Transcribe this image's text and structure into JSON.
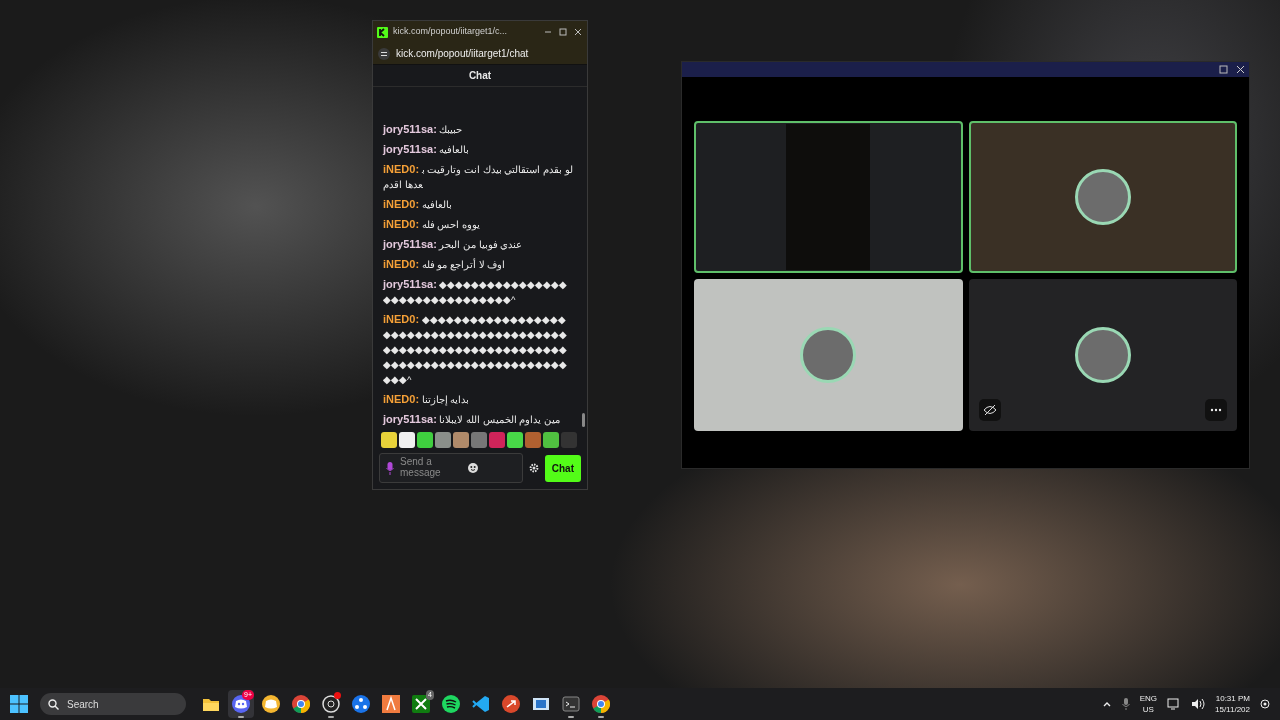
{
  "chat_window": {
    "title": "kick.com/popout/iitarget1/c...",
    "address": "kick.com/popout/iitarget1/chat",
    "header": "Chat",
    "messages": [
      {
        "user": "jory511sa:",
        "color": "#e4c9dd",
        "text": "حبيبك"
      },
      {
        "user": "jory511sa:",
        "color": "#e4c9dd",
        "text": "بالعافيه"
      },
      {
        "user": "iNED0:",
        "color": "#f5a037",
        "text": "لو بقدم استقالتي بيدك انت وتارقيت بعدها اقدم"
      },
      {
        "user": "iNED0:",
        "color": "#f5a037",
        "text": "بالعافيه"
      },
      {
        "user": "iNED0:",
        "color": "#f5a037",
        "text": "يووه احس فله"
      },
      {
        "user": "jory511sa:",
        "color": "#e4c9dd",
        "text": "عندي فوبيا من البحر"
      },
      {
        "user": "iNED0:",
        "color": "#f5a037",
        "text": "اوف لا أتراجع مو فله"
      },
      {
        "user": "jory511sa:",
        "color": "#e4c9dd",
        "text": "◆◆◆◆◆◆◆◆◆◆◆◆◆◆◆◆◆◆◆◆◆◆◆◆◆◆◆◆◆◆◆◆^"
      },
      {
        "user": "iNED0:",
        "color": "#f5a037",
        "text": "◆◆◆◆◆◆◆◆◆◆◆◆◆◆◆◆◆◆◆◆◆◆◆◆◆◆◆◆◆◆◆◆◆◆◆◆◆◆◆◆◆◆◆◆◆◆◆◆◆◆◆◆◆◆◆◆◆◆◆◆◆◆◆◆◆◆◆◆◆◆◆◆◆◆◆◆◆◆◆◆◆◆◆◆◆◆◆◆◆◆^"
      },
      {
        "user": "iNED0:",
        "color": "#f5a037",
        "text": "بدايه إجازتنا"
      },
      {
        "user": "jory511sa:",
        "color": "#e4c9dd",
        "text": "مين يداوم الخميس الله لايبلانا"
      }
    ],
    "input": {
      "placeholder": "Send a message"
    },
    "send_button": "Chat"
  },
  "call_window": {
    "tiles": [
      {
        "kind": "video",
        "speaking": true,
        "color": "#1e1f22"
      },
      {
        "kind": "avatar",
        "speaking": true,
        "color": "#3a3025"
      },
      {
        "kind": "avatar",
        "speaking": false,
        "color": "#c0c2bf"
      },
      {
        "kind": "avatar",
        "speaking": false,
        "color": "#232325",
        "controls": true
      }
    ]
  },
  "taskbar": {
    "search": {
      "placeholder": "Search"
    },
    "apps": [
      {
        "kind": "folder",
        "running": false,
        "selected": false
      },
      {
        "kind": "discord",
        "running": true,
        "selected": true,
        "badge": "9+"
      },
      {
        "kind": "yellow-chat",
        "running": false,
        "selected": false
      },
      {
        "kind": "browser",
        "running": false,
        "selected": false
      },
      {
        "kind": "aperture",
        "running": true,
        "selected": false,
        "dot": true
      },
      {
        "kind": "blue-network",
        "running": false,
        "selected": false
      },
      {
        "kind": "orange-tile",
        "running": false,
        "selected": false
      },
      {
        "kind": "green-tile",
        "running": false,
        "selected": false,
        "badge": "4"
      },
      {
        "kind": "green-circle",
        "running": false,
        "selected": false
      },
      {
        "kind": "code",
        "running": false,
        "selected": false
      },
      {
        "kind": "red-circle",
        "running": false,
        "selected": false
      },
      {
        "kind": "window",
        "running": false,
        "selected": false
      },
      {
        "kind": "terminal",
        "running": true,
        "selected": false
      },
      {
        "kind": "browser",
        "running": true,
        "selected": false
      }
    ],
    "language": [
      "ENG",
      "US"
    ],
    "time": "10:31 PM",
    "date": "15/11/202"
  }
}
